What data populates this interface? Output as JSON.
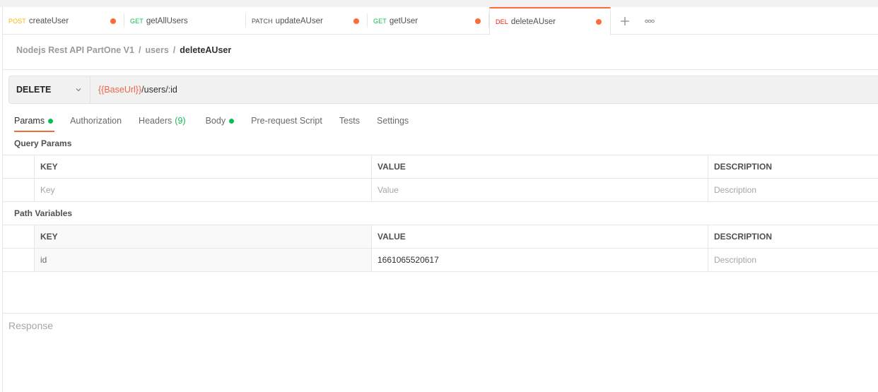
{
  "tabs": [
    {
      "method": "POST",
      "method_color": "#ffb400",
      "name": "createUser",
      "unsaved": true,
      "active": false
    },
    {
      "method": "GET",
      "method_color": "#0cbb52",
      "name": "getAllUsers",
      "unsaved": false,
      "active": false
    },
    {
      "method": "PATCH",
      "method_color": "#505050",
      "name": "updateAUser",
      "unsaved": true,
      "active": false
    },
    {
      "method": "GET",
      "method_color": "#0cbb52",
      "name": "getUser",
      "unsaved": true,
      "active": false
    },
    {
      "method": "DEL",
      "method_color": "#eb2013",
      "name": "deleteAUser",
      "unsaved": true,
      "active": true
    }
  ],
  "tab_actions": {
    "add_icon": "plus-icon",
    "more_icon": "ellipsis-icon"
  },
  "breadcrumb": {
    "collection": "Nodejs Rest API PartOne V1",
    "folder": "users",
    "request": "deleteAUser",
    "separator": "/"
  },
  "request": {
    "method": "DELETE",
    "url_variable": "{{BaseUrl}}",
    "url_path": "/users/:id"
  },
  "request_tabs": {
    "params": "Params",
    "authorization": "Authorization",
    "headers": "Headers",
    "headers_count": "(9)",
    "body": "Body",
    "prerequest": "Pre-request Script",
    "tests": "Tests",
    "settings": "Settings",
    "active": "Params"
  },
  "query_params": {
    "title": "Query Params",
    "columns": [
      "KEY",
      "VALUE",
      "DESCRIPTION"
    ],
    "placeholder_row": {
      "key": "Key",
      "value": "Value",
      "description": "Description"
    }
  },
  "path_variables": {
    "title": "Path Variables",
    "columns": [
      "KEY",
      "VALUE",
      "DESCRIPTION"
    ],
    "rows": [
      {
        "key": "id",
        "value": "1661065520617",
        "description_placeholder": "Description"
      }
    ]
  },
  "response": {
    "label": "Response"
  },
  "colors": {
    "accent": "#ff6c37",
    "active_dot": "#0cbb52",
    "url_variable": "#f06449"
  }
}
